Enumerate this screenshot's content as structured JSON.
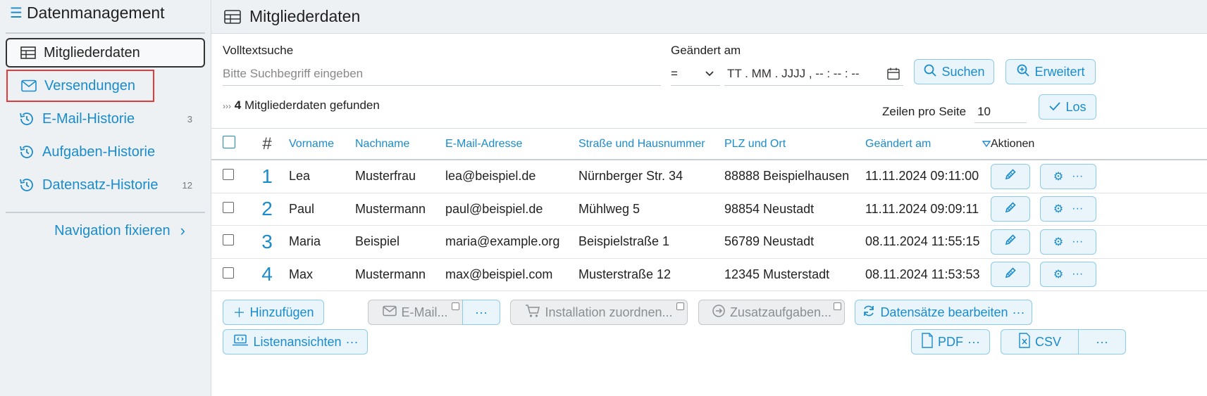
{
  "sidebar": {
    "title": "Datenmanagement",
    "items": [
      {
        "label": "Mitgliederdaten",
        "badge": ""
      },
      {
        "label": "Versendungen",
        "badge": ""
      },
      {
        "label": "E-Mail-Historie",
        "badge": "3"
      },
      {
        "label": "Aufgaben-Historie",
        "badge": ""
      },
      {
        "label": "Datensatz-Historie",
        "badge": "12"
      }
    ],
    "fix_label": "Navigation fixieren"
  },
  "header": {
    "title": "Mitgliederdaten"
  },
  "filters": {
    "search_label": "Volltextsuche",
    "search_placeholder": "Bitte Suchbegriff eingeben",
    "date_label": "Geändert am",
    "date_operator": "=",
    "date_placeholder": "TT . MM . JJJJ ,  -- : -- : --",
    "search_button": "Suchen",
    "advanced_button": "Erweitert"
  },
  "results": {
    "count": "4",
    "text": "Mitgliederdaten gefunden",
    "arrows": "›››"
  },
  "paging": {
    "rows_label": "Zeilen pro Seite",
    "rows_value": "10",
    "go_button": "Los"
  },
  "table": {
    "headers": {
      "num": "#",
      "vorname": "Vorname",
      "nachname": "Nachname",
      "email": "E-Mail-Adresse",
      "strasse": "Straße und Hausnummer",
      "plz": "PLZ und Ort",
      "geaendert": "Geändert am",
      "aktionen": "Aktionen"
    },
    "rows": [
      {
        "num": "1",
        "vorname": "Lea",
        "nachname": "Musterfrau",
        "email": "lea@beispiel.de",
        "strasse": "Nürnberger Str. 34",
        "plz": "88888 Beispielhausen",
        "geaendert": "11.11.2024 09:11:00"
      },
      {
        "num": "2",
        "vorname": "Paul",
        "nachname": "Mustermann",
        "email": "paul@beispiel.de",
        "strasse": "Mühlweg 5",
        "plz": "98854 Neustadt",
        "geaendert": "11.11.2024 09:09:11"
      },
      {
        "num": "3",
        "vorname": "Maria",
        "nachname": "Beispiel",
        "email": "maria@example.org",
        "strasse": "Beispielstraße 1",
        "plz": "56789 Neustadt",
        "geaendert": "08.11.2024 11:55:15"
      },
      {
        "num": "4",
        "vorname": "Max",
        "nachname": "Mustermann",
        "email": "max@beispiel.com",
        "strasse": "Musterstraße 12",
        "plz": "12345 Musterstadt",
        "geaendert": "08.11.2024 11:53:53"
      }
    ]
  },
  "actions": {
    "add": "Hinzufügen",
    "email": "E-Mail...",
    "install": "Installation zuordnen...",
    "extra": "Zusatzaufgaben...",
    "edit_records": "Datensätze bearbeiten",
    "list_views": "Listenansichten",
    "pdf": "PDF",
    "csv": "CSV",
    "more": "···"
  },
  "colors": {
    "accent": "#1a8ccc",
    "sidebar_bg": "#edf1f4",
    "highlight": "#e23b3b"
  }
}
